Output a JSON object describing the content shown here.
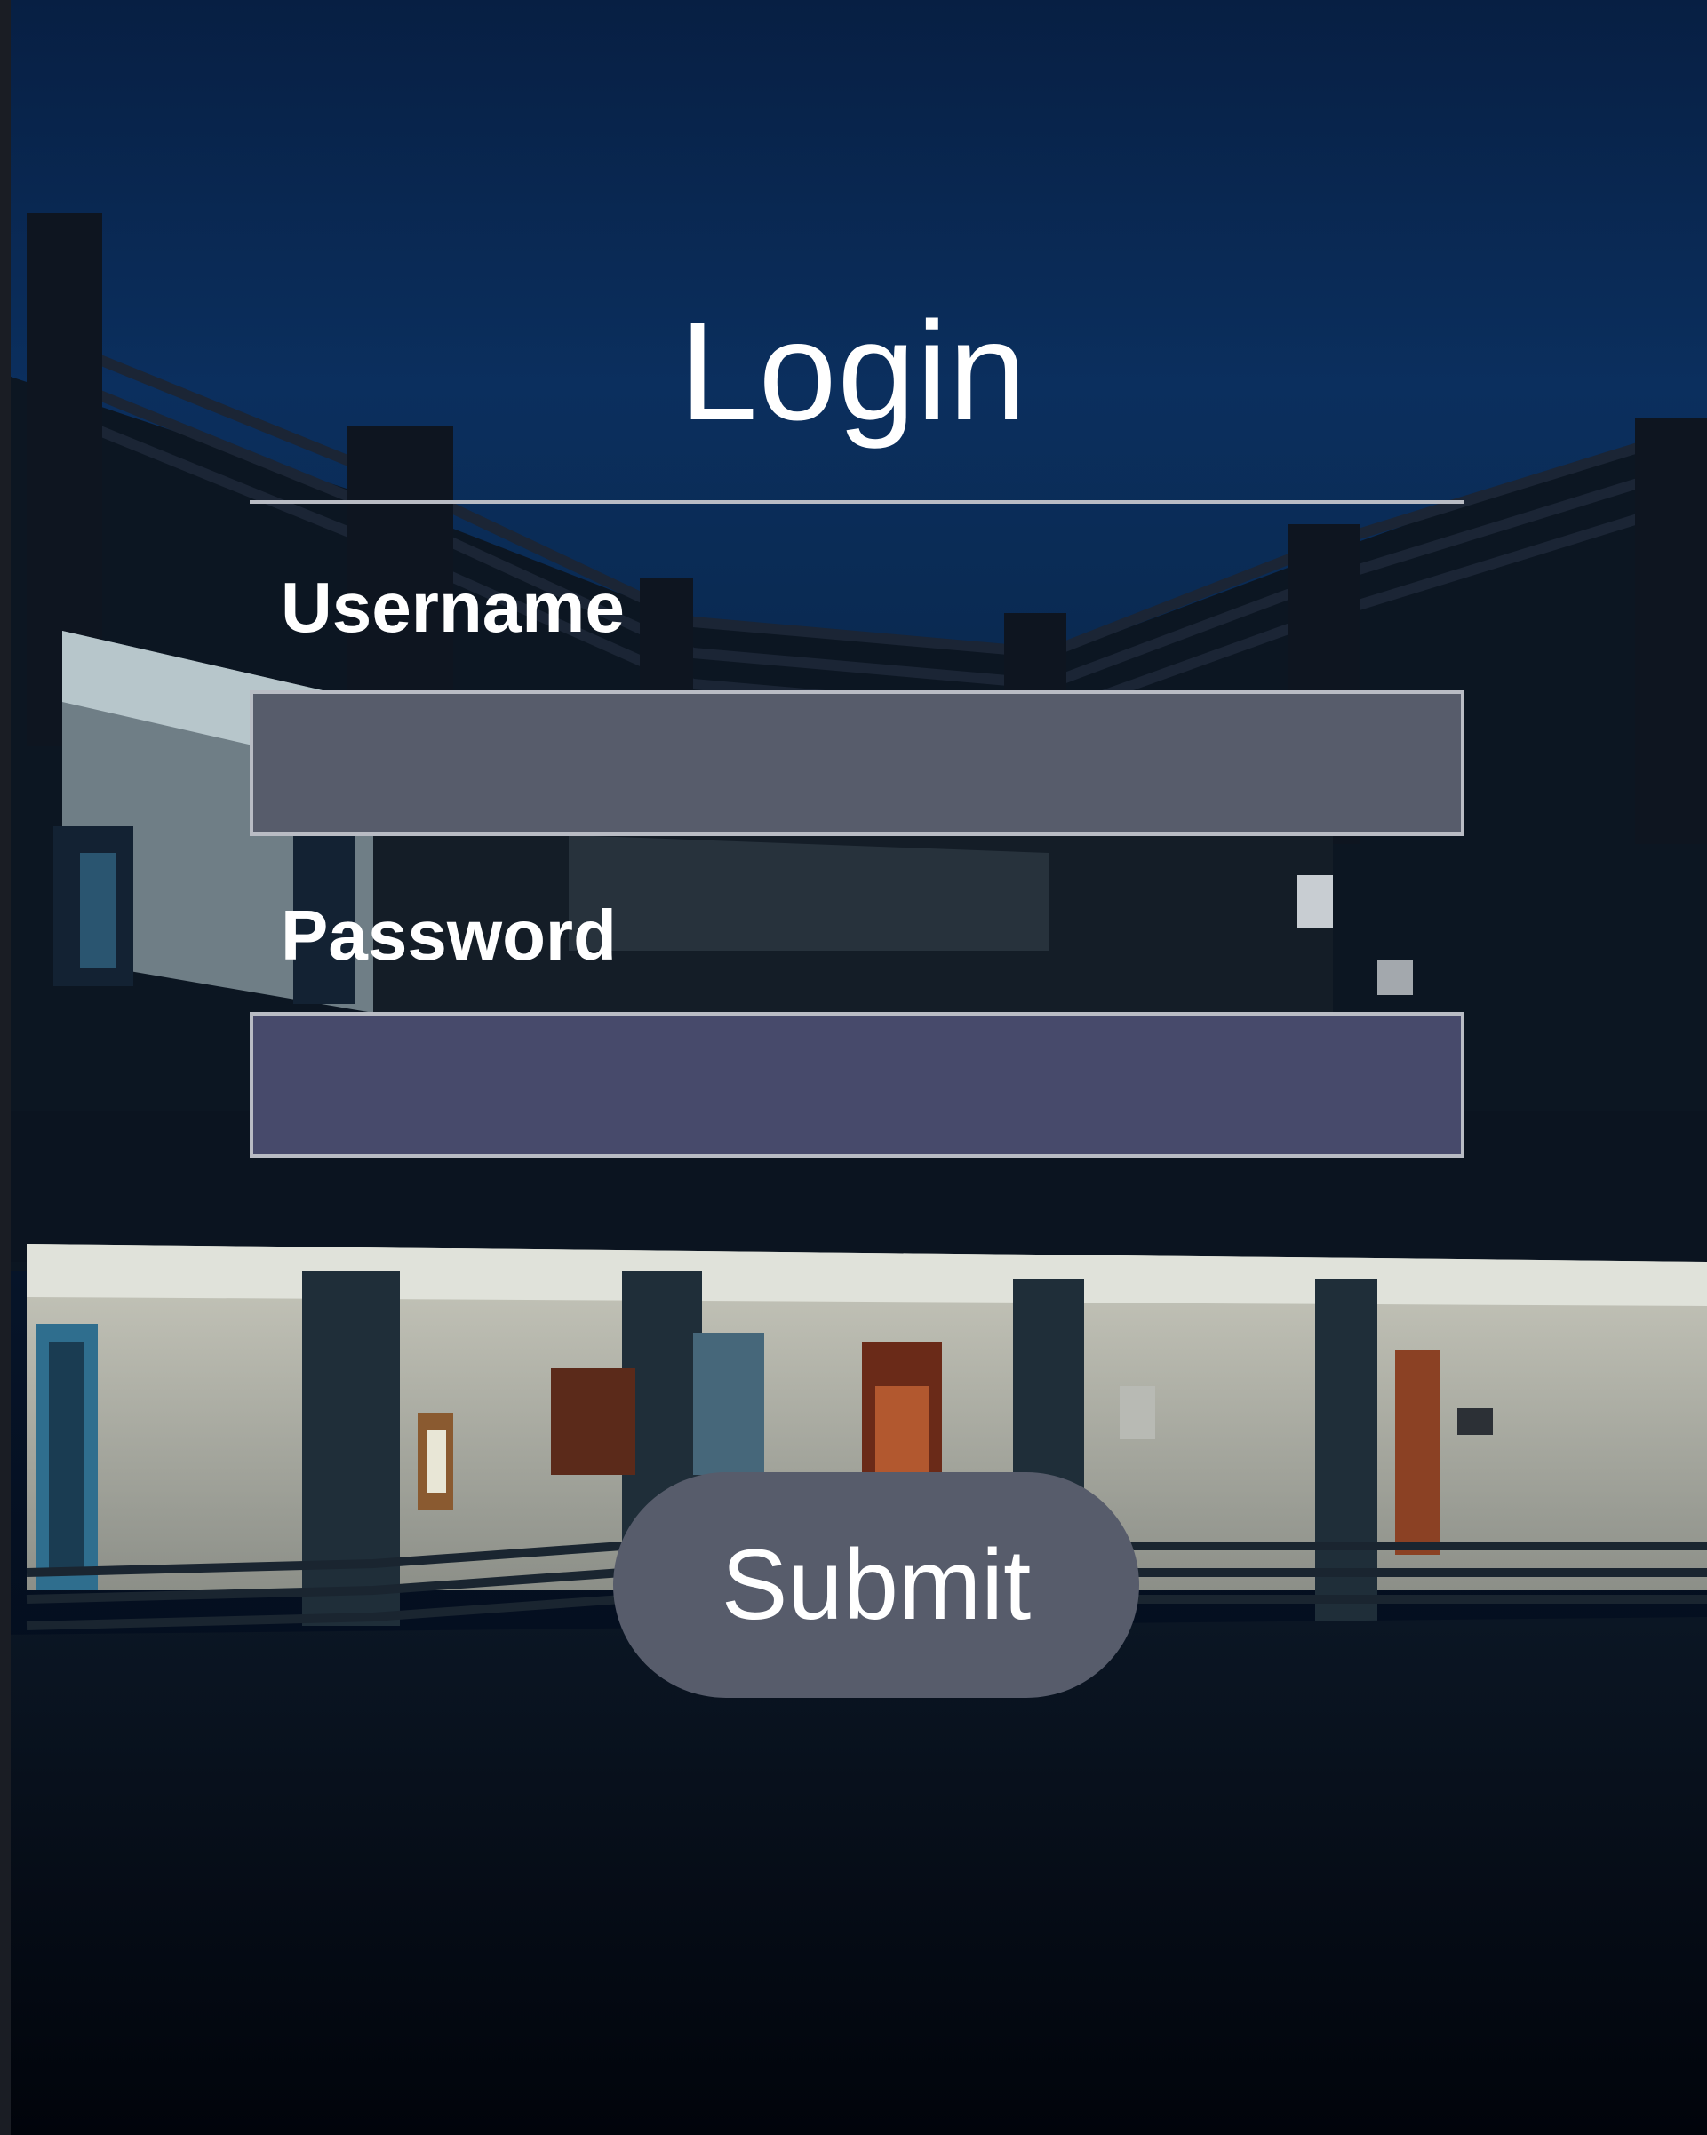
{
  "login": {
    "title": "Login",
    "username_label": "Username",
    "username_value": "",
    "password_label": "Password",
    "password_value": "",
    "submit_label": "Submit"
  },
  "colors": {
    "sky": "#0a2a55",
    "input_username_bg": "#575c6b",
    "input_password_bg": "#474a6b",
    "button_bg": "#575c6b",
    "text": "#ffffff",
    "border": "#b9bcc4"
  }
}
